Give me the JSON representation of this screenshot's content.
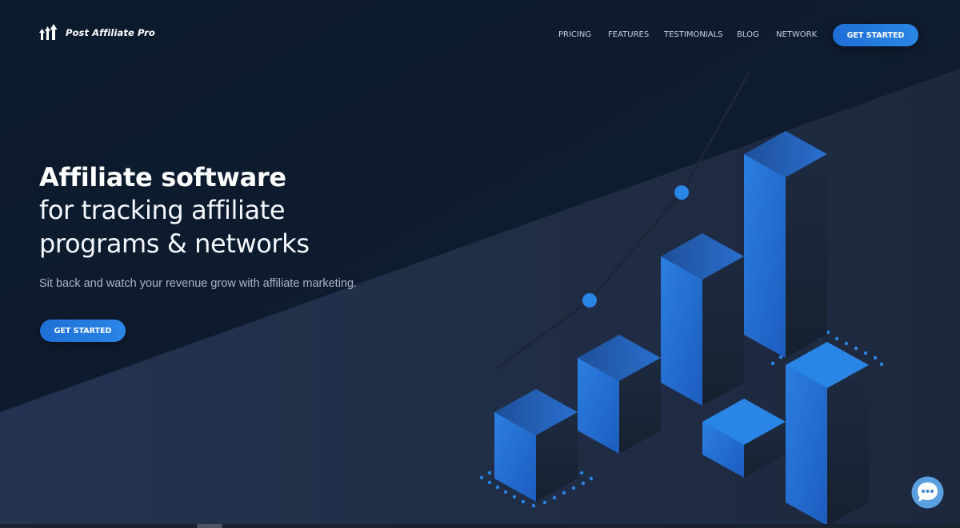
{
  "brand": {
    "name": "Post Affiliate Pro",
    "logo_icon": "rising-arrows-logo"
  },
  "nav": {
    "items": [
      {
        "label": "PRICING"
      },
      {
        "label": "FEATURES"
      },
      {
        "label": "TESTIMONIALS"
      },
      {
        "label": "BLOG"
      },
      {
        "label": "NETWORK"
      }
    ],
    "cta_label": "GET STARTED"
  },
  "hero": {
    "title_bold": "Affiliate software",
    "title_line2": "for tracking affiliate",
    "title_line3": "programs & networks",
    "subtitle": "Sit back and watch your revenue grow with affiliate marketing.",
    "cta_label": "GET STARTED"
  },
  "chat": {
    "icon": "chat-bubble-icon"
  },
  "colors": {
    "background_dark": "#0d1b2e",
    "background_band": "#1f2c44",
    "accent_blue": "#2a86e6",
    "nav_text": "#c9d3e0",
    "subtitle_text": "#aab6c6"
  }
}
